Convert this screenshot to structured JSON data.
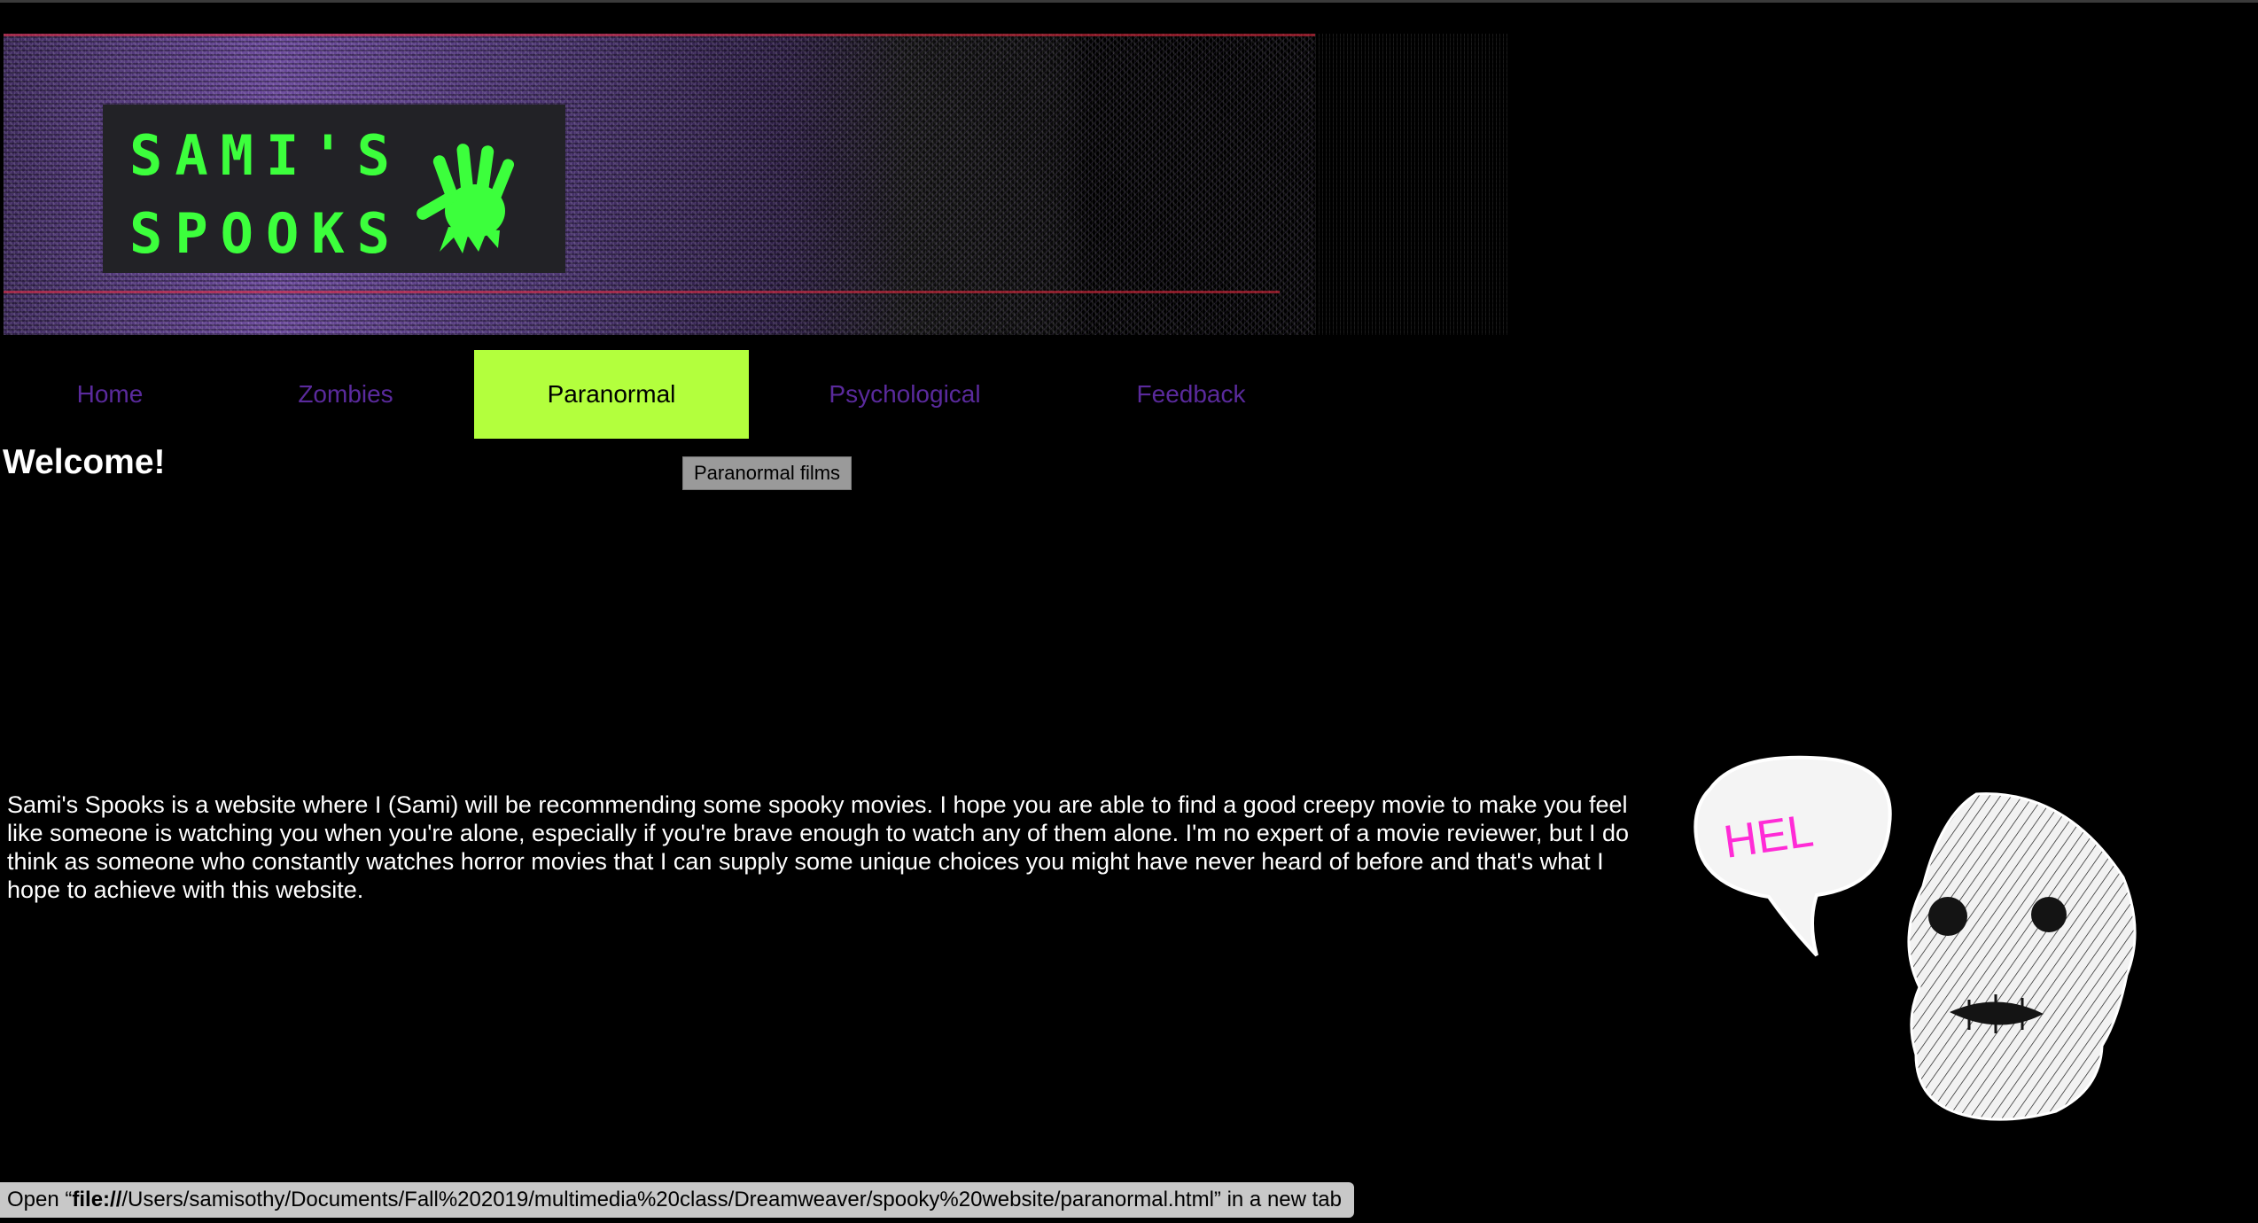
{
  "banner": {
    "logo_line1": "SAMI'S",
    "logo_line2": "SPOOKS",
    "logo_color": "#3cff3c",
    "logo_icon": "handprint-icon"
  },
  "nav": {
    "items": [
      {
        "label": "Home",
        "active": false
      },
      {
        "label": "Zombies",
        "active": false
      },
      {
        "label": "Paranormal",
        "active": true
      },
      {
        "label": "Psychological",
        "active": false
      },
      {
        "label": "Feedback",
        "active": false
      }
    ],
    "active_bg": "#b3ff3d",
    "link_color": "#5a2a9c"
  },
  "tooltip": "Paranormal films",
  "main": {
    "heading": "Welcome!",
    "intro": "Sami's Spooks is a website where I (Sami) will be recommending some spooky movies. I hope you are able to find a good creepy movie to make you feel like someone is watching you when you're alone, especially if you're brave enough to watch any of them alone. I'm no expert of a movie reviewer, but I do think as someone who constantly watches horror movies that I can supply some unique choices you might have never heard of before and that's what I hope to achieve with this website.",
    "illustration": {
      "icon": "ghost-illustration-icon",
      "speech_text": "HEL",
      "speech_color": "#ff2bd6"
    }
  },
  "statusbar": {
    "prefix": "Open “",
    "url_bold": "file://",
    "url_rest": "/Users/samisothy/Documents/Fall%202019/multimedia%20class/Dreamweaver/spooky%20website/paranormal.html",
    "suffix": "” in a new tab"
  }
}
